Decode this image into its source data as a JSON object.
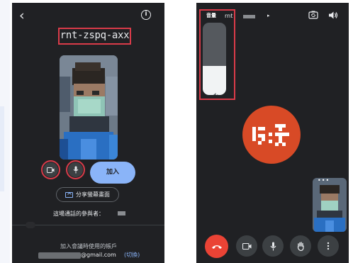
{
  "screen1": {
    "meeting_code": "rnt-zspq-axx",
    "join_label": "加入",
    "share_label": "分享螢幕畫面",
    "participants_label": "這場通話的參與者：",
    "account_label": "加入會議時使用的帳戶",
    "account_email": "@gmail.com",
    "account_switch": "(切換)",
    "icons": [
      "back-arrow-icon",
      "info-icon",
      "camera-icon",
      "microphone-icon",
      "share-screen-icon"
    ]
  },
  "screen2": {
    "volume_label": "音量",
    "meeting_code_partial": "rnt",
    "volume_level_percent": 40,
    "end_call_color": "#ea4335",
    "avatar_color": "#d84a26",
    "icons": [
      "switch-camera-icon",
      "speaker-icon",
      "volume-icon",
      "end-call-icon",
      "camera-icon",
      "microphone-icon",
      "raise-hand-icon",
      "more-vert-icon"
    ]
  },
  "colors": {
    "highlight": "#d93b49",
    "join_button": "#8ab4f8",
    "background": "#202124"
  }
}
